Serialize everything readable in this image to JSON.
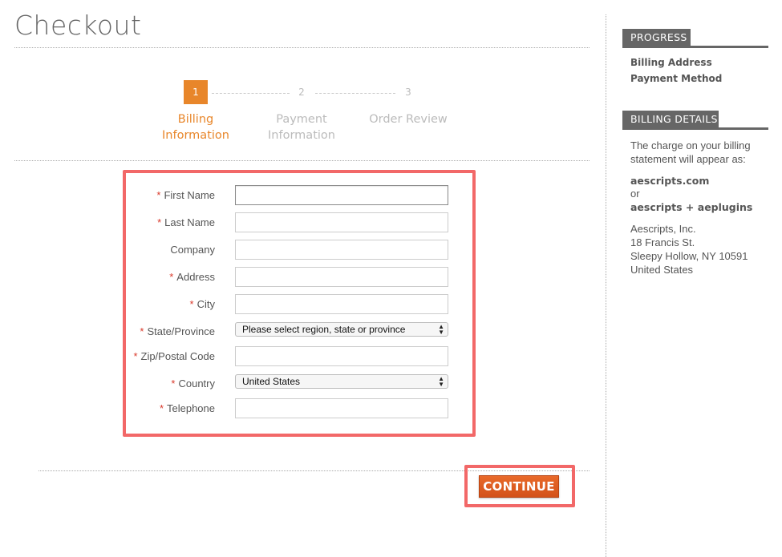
{
  "page": {
    "title": "Checkout"
  },
  "steps": [
    {
      "number": "1",
      "line1": "Billing",
      "line2": "Information",
      "active": true
    },
    {
      "number": "2",
      "line1": "Payment",
      "line2": "Information",
      "active": false
    },
    {
      "number": "3",
      "line1": "Order Review",
      "line2": "",
      "active": false
    }
  ],
  "form": {
    "required_mark": "*",
    "fields": [
      {
        "label": "First Name",
        "value": "",
        "placeholder": ""
      },
      {
        "label": "Last Name",
        "value": "",
        "placeholder": ""
      },
      {
        "label": "Company",
        "value": "",
        "placeholder": ""
      },
      {
        "label": "Address",
        "value": "",
        "placeholder": ""
      },
      {
        "label": "City",
        "value": "",
        "placeholder": ""
      },
      {
        "label": "State/Province",
        "value": "Please select region, state or province"
      },
      {
        "label": "Zip/Postal Code",
        "value": "",
        "placeholder": ""
      },
      {
        "label": "Country",
        "value": "United States"
      },
      {
        "label": "Telephone",
        "value": "",
        "placeholder": ""
      }
    ],
    "select_arrows": "▲▼"
  },
  "actions": {
    "continue_label": "CONTINUE"
  },
  "sidebar": {
    "progress": {
      "heading": "PROGRESS",
      "items": [
        "Billing Address",
        "Payment Method"
      ]
    },
    "billing": {
      "heading": "BILLING DETAILS",
      "intro": "The charge on your billing statement will appear as:",
      "name1": "aescripts.com",
      "or": "or",
      "name2": "aescripts + aeplugins",
      "address": [
        "Aescripts, Inc.",
        "18 Francis St.",
        "Sleepy Hollow, NY 10591",
        "United States"
      ]
    }
  },
  "colors": {
    "accent": "#e8862a",
    "highlight": "#f26868",
    "button": "#d9561c",
    "sidebar_head": "#666666"
  }
}
